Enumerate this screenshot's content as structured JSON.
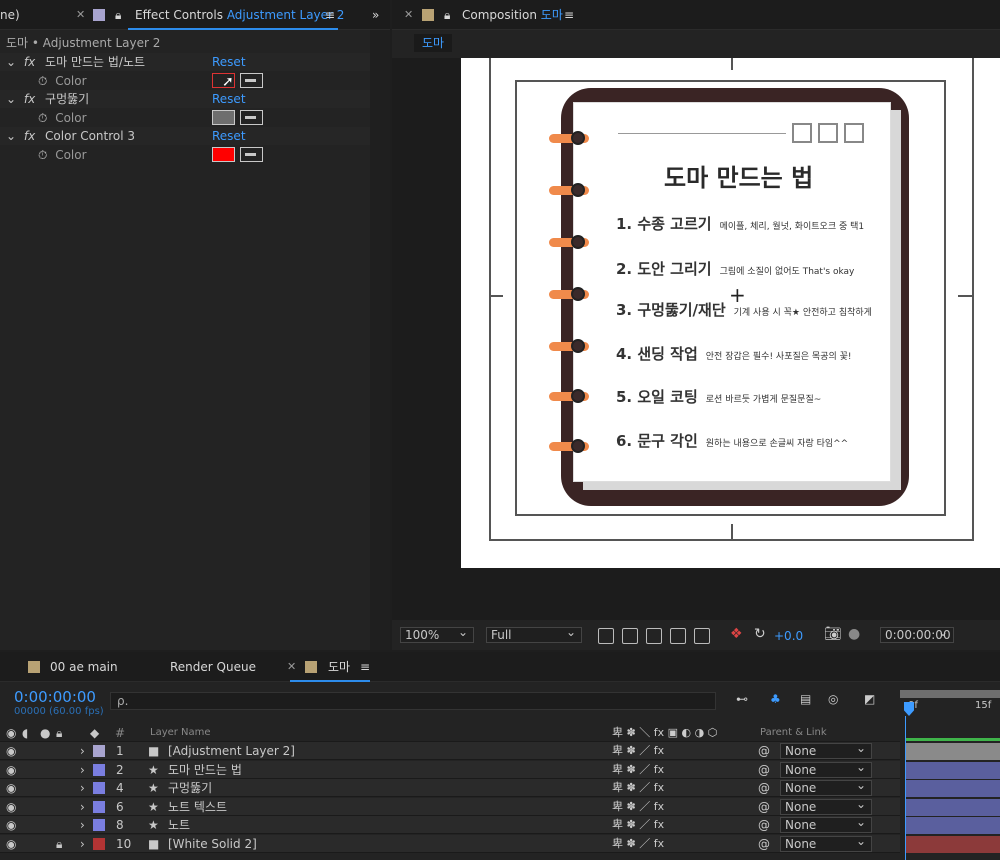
{
  "effect_panel": {
    "partial_tab": "ne)",
    "tab_title": "Effect Controls",
    "tab_layer": "Adjustment Layer 2",
    "header": "도마 • Adjustment Layer 2",
    "effects": [
      {
        "name": "도마 만드는 법/노트",
        "reset": "Reset",
        "prop": "Color",
        "swatch": "#222222"
      },
      {
        "name": "구멍뚫기",
        "reset": "Reset",
        "prop": "Color",
        "swatch": "#6e6e6e"
      },
      {
        "name": "Color Control 3",
        "reset": "Reset",
        "prop": "Color",
        "swatch": "#ff0000"
      }
    ]
  },
  "comp_panel": {
    "tab_title": "Composition",
    "tab_comp": "도마",
    "breadcrumb": "도마",
    "zoom": "100%",
    "resolution": "Full",
    "exposure": "+0.0",
    "timecode": "0:00:00:00"
  },
  "notebook": {
    "title": "도마 만드는 법",
    "items": [
      {
        "main": "1. 수종 고르기",
        "sub": "메이플, 체리, 월넛, 화이트오크 중 택1"
      },
      {
        "main": "2. 도안 그리기",
        "sub": "그림에 소질이 없어도 That's okay"
      },
      {
        "main": "3. 구멍뚫기/재단",
        "sub": "기계 사용 시 꼭★ 안전하고 침착하게"
      },
      {
        "main": "4. 샌딩 작업",
        "sub": "안전 장갑은 필수! 사포질은 목공의 꽃!"
      },
      {
        "main": "5. 오일 코팅",
        "sub": "로션 바르듯 가볍게 문질문질~"
      },
      {
        "main": "6. 문구 각인",
        "sub": "원하는 내용으로 손글씨 자랑 타임^^"
      }
    ],
    "colors": {
      "cover": "#3a2424",
      "ring": "#f08a4b",
      "page": "#ffffff"
    }
  },
  "timeline": {
    "tabs": [
      "00 ae main",
      "Render Queue",
      "도마"
    ],
    "timecode": "0:00:00:00",
    "fps": "00000 (60.00 fps)",
    "search_placeholder": "ρ.",
    "col_num": "#",
    "col_layer": "Layer Name",
    "col_parent": "Parent & Link",
    "ruler": [
      "0f",
      "15f"
    ],
    "layers": [
      {
        "num": "1",
        "name": "[Adjustment Layer 2]",
        "label": "#a8a4cf",
        "parent": "None",
        "star": false,
        "bar": "#8a8a8a"
      },
      {
        "num": "2",
        "name": "도마 만드는 법",
        "label": "#7a7ee0",
        "parent": "None",
        "star": true,
        "bar": "#5a5f9e"
      },
      {
        "num": "4",
        "name": "구멍뚫기",
        "label": "#7a7ee0",
        "parent": "None",
        "star": true,
        "bar": "#5a5f9e"
      },
      {
        "num": "6",
        "name": "노트 텍스트",
        "label": "#7a7ee0",
        "parent": "None",
        "star": true,
        "bar": "#5a5f9e"
      },
      {
        "num": "8",
        "name": "노트",
        "label": "#7a7ee0",
        "parent": "None",
        "star": true,
        "bar": "#5a5f9e"
      },
      {
        "num": "10",
        "name": "[White Solid 2]",
        "label": "#b33434",
        "parent": "None",
        "star": false,
        "bar": "#8c3a3a"
      }
    ]
  }
}
